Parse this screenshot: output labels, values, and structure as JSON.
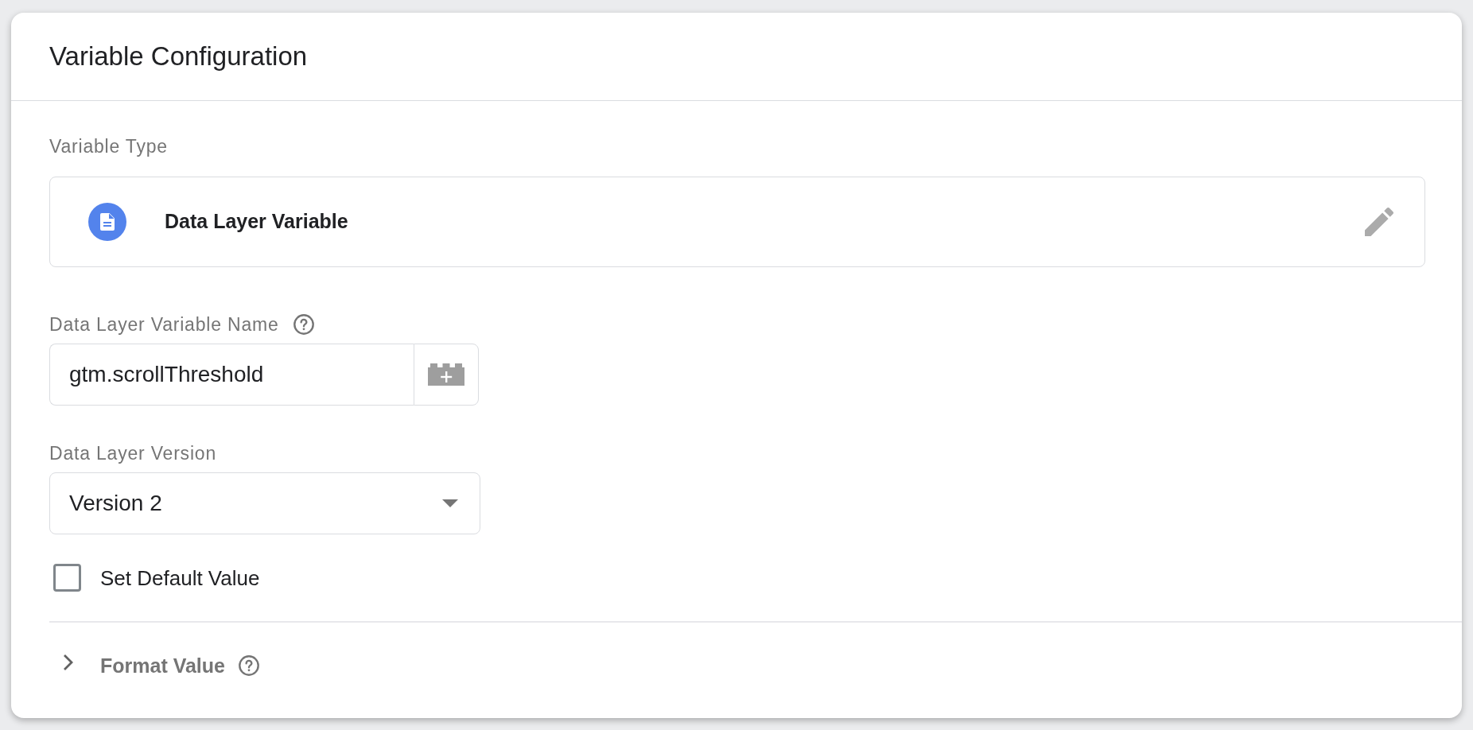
{
  "panel": {
    "title": "Variable Configuration"
  },
  "variable_type": {
    "label": "Variable Type",
    "name": "Data Layer Variable"
  },
  "fields": [
    {
      "kind": "text",
      "label": "Data Layer Variable Name",
      "help": true,
      "value": "gtm.scrollThreshold"
    },
    {
      "kind": "select",
      "label": "Data Layer Version",
      "help": false,
      "value": "Version 2"
    }
  ],
  "default_value": {
    "label": "Set Default Value",
    "checked": false
  },
  "format_value": {
    "label": "Format Value",
    "expanded": false,
    "help": true
  }
}
